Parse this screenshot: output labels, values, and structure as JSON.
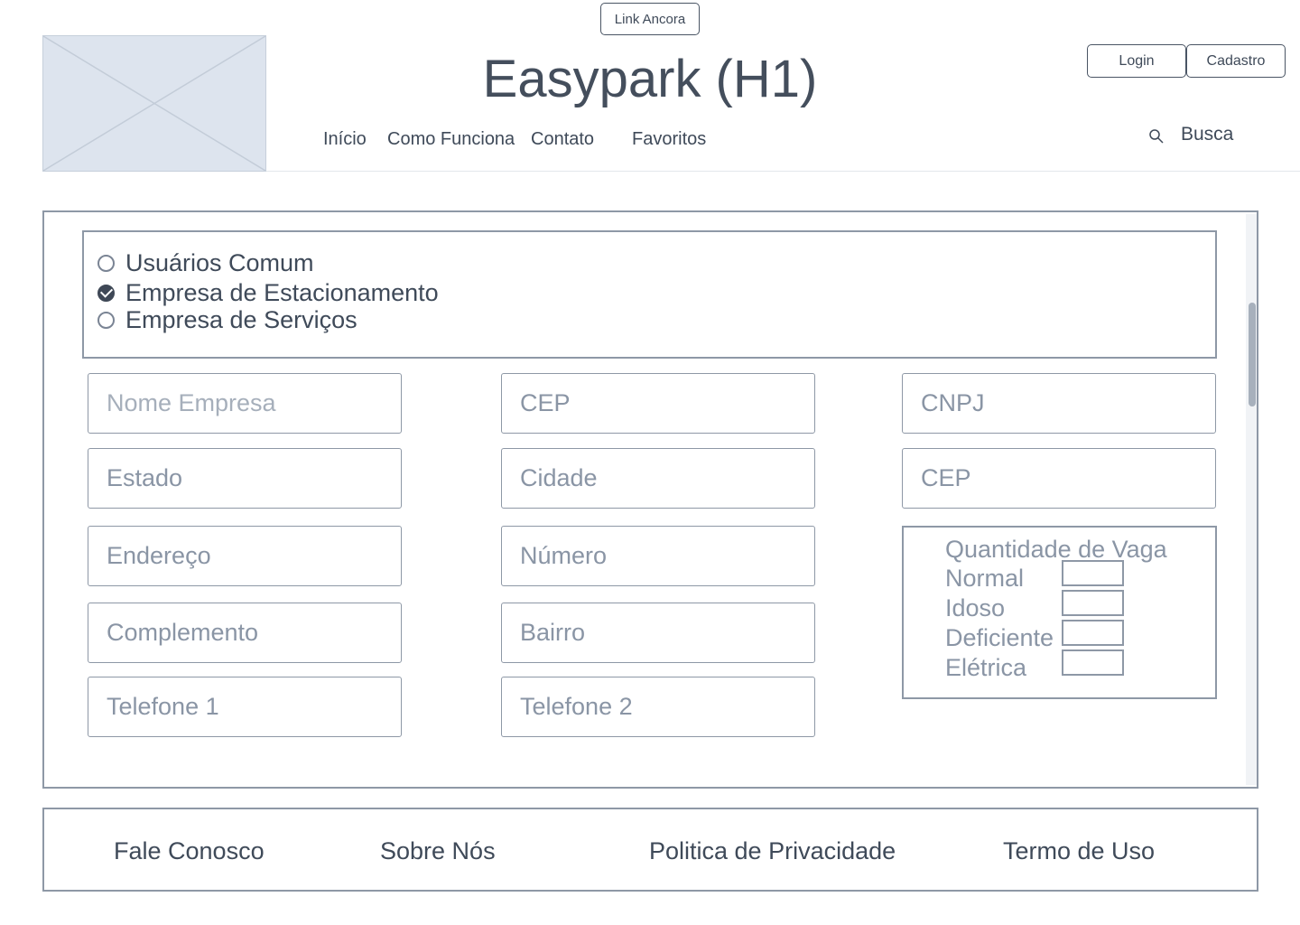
{
  "header": {
    "anchor_link": "Link Ancora",
    "title": "Easypark (H1)",
    "nav": [
      "Início",
      "Como Funciona",
      "Contato",
      "Favoritos"
    ],
    "login": "Login",
    "signup": "Cadastro",
    "search_label": "Busca",
    "logo": "image-placeholder-icon",
    "search_icon": "search-icon"
  },
  "account_types": {
    "options": [
      {
        "label": "Usuários Comum",
        "checked": false
      },
      {
        "label": "Empresa de Estacionamento",
        "checked": true
      },
      {
        "label": "Empresa de Serviços",
        "checked": false
      }
    ]
  },
  "form": {
    "nome_empresa": "Nome Empresa",
    "cep": "CEP",
    "cnpj": "CNPJ",
    "estado": "Estado",
    "cidade": "Cidade",
    "cep_2": "CEP",
    "endereco": "Endereço",
    "numero": "Número",
    "complemento": "Complemento",
    "bairro": "Bairro",
    "telefone_1": "Telefone 1",
    "telefone_2": "Telefone 2"
  },
  "vagas": {
    "title": "Quantidade de Vaga",
    "rows": [
      "Normal",
      "Idoso",
      "Deficiente",
      "Elétrica"
    ]
  },
  "footer": {
    "links": [
      "Fale Conosco",
      "Sobre Nós",
      "Politica de Privacidade",
      "Termo de Uso"
    ]
  },
  "colors": {
    "border": "#8e98a6",
    "text": "#3f4a59",
    "placeholder": "#8a95a5",
    "logo_fill": "#dde4ee"
  }
}
